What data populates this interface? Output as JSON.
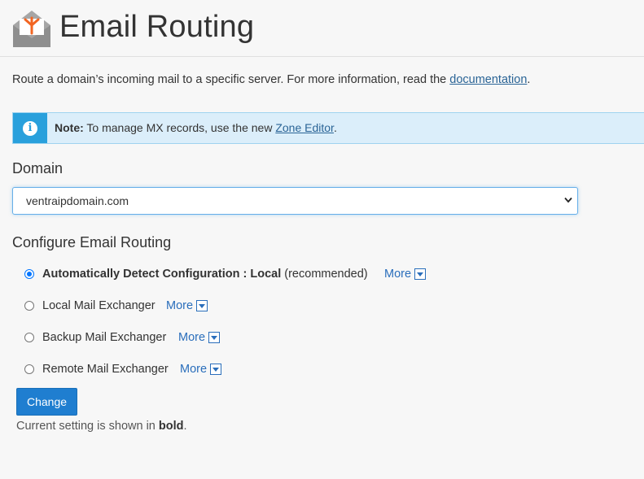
{
  "header": {
    "title": "Email Routing",
    "icon": "email-routing-icon"
  },
  "intro": {
    "text": "Route a domain’s incoming mail to a specific server. For more information, read the ",
    "link": "documentation",
    "end": "."
  },
  "note": {
    "icon": "info-icon",
    "label": "Note:",
    "text": " To manage MX records, use the new ",
    "link": "Zone Editor",
    "end": "."
  },
  "domain": {
    "label": "Domain",
    "selected": "ventraipdomain.com"
  },
  "routing": {
    "label": "Configure Email Routing",
    "options": [
      {
        "label_bold": "Automatically Detect Configuration : Local",
        "suffix": " (recommended)",
        "more": "More",
        "checked": true
      },
      {
        "label": "Local Mail Exchanger",
        "more": "More",
        "checked": false
      },
      {
        "label": "Backup Mail Exchanger",
        "more": "More",
        "checked": false
      },
      {
        "label": "Remote Mail Exchanger",
        "more": "More",
        "checked": false
      }
    ]
  },
  "change_button": "Change",
  "footnote": {
    "text": "Current setting is shown in ",
    "bold": "bold",
    "end": "."
  },
  "colors": {
    "accent": "#1f7ed0",
    "info": "#29a0dc",
    "note_bg": "#dbeefa",
    "link": "#2a6496"
  }
}
